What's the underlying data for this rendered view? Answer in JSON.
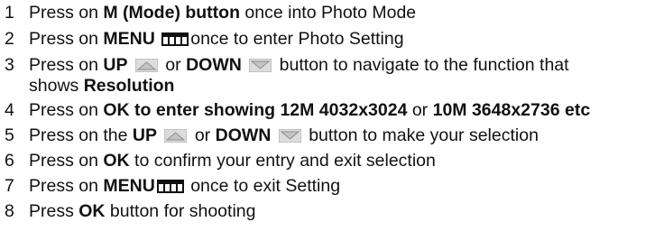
{
  "steps": [
    {
      "num": "1",
      "parts": [
        {
          "t": "Press on "
        },
        {
          "t": "M (Mode) button",
          "b": true
        },
        {
          "t": " once into Photo Mode"
        }
      ]
    },
    {
      "num": "2",
      "parts": [
        {
          "t": "Press on "
        },
        {
          "t": "MENU",
          "b": true
        },
        {
          "t": " "
        },
        {
          "icon": "menu-icon"
        },
        {
          "t": "once to enter Photo Setting"
        }
      ]
    },
    {
      "num": "3",
      "parts": [
        {
          "t": "Press on "
        },
        {
          "t": "UP",
          "b": true
        },
        {
          "t": " "
        },
        {
          "icon": "up-arrow-icon"
        },
        {
          "t": " or "
        },
        {
          "t": "DOWN",
          "b": true
        },
        {
          "t": " "
        },
        {
          "icon": "down-arrow-icon"
        },
        {
          "t": " button to navigate to the function that"
        }
      ]
    },
    {
      "num": "",
      "parts": [
        {
          "t": "shows "
        },
        {
          "t": "Resolution",
          "b": true
        }
      ]
    },
    {
      "num": "4",
      "parts": [
        {
          "t": "Press on "
        },
        {
          "t": "OK to enter showing 12M 4032x3024",
          "b": true
        },
        {
          "t": " or "
        },
        {
          "t": "10M 3648x2736 etc",
          "b": true
        }
      ]
    },
    {
      "num": "5",
      "parts": [
        {
          "t": "Press on the "
        },
        {
          "t": "UP",
          "b": true
        },
        {
          "t": " "
        },
        {
          "icon": "up-arrow-icon"
        },
        {
          "t": " or "
        },
        {
          "t": "DOWN",
          "b": true
        },
        {
          "t": " "
        },
        {
          "icon": "down-arrow-icon"
        },
        {
          "t": " button to make your selection"
        }
      ]
    },
    {
      "num": "6",
      "parts": [
        {
          "t": "Press on "
        },
        {
          "t": "OK",
          "b": true
        },
        {
          "t": " to confirm your entry and exit selection"
        }
      ]
    },
    {
      "num": "7",
      "parts": [
        {
          "t": "Press on "
        },
        {
          "t": "MENU",
          "b": true
        },
        {
          "icon": "menu-icon"
        },
        {
          "t": " once to exit Setting"
        }
      ]
    },
    {
      "num": "8",
      "parts": [
        {
          "t": "Press "
        },
        {
          "t": "OK",
          "b": true
        },
        {
          "t": " button for shooting"
        }
      ]
    }
  ]
}
